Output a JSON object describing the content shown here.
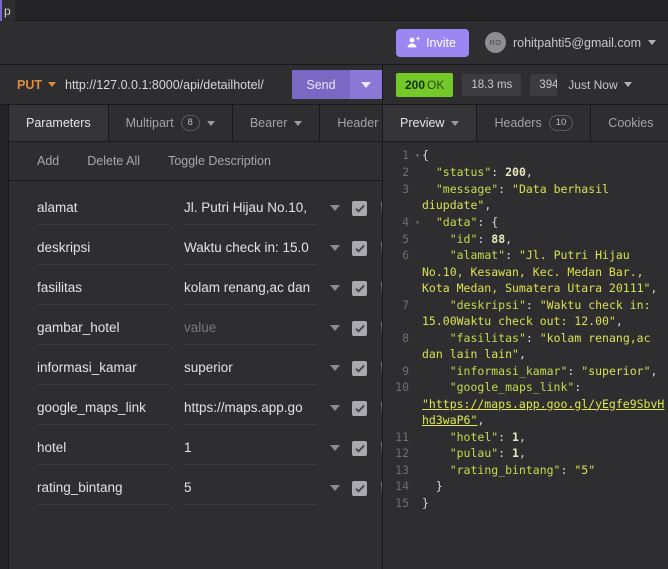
{
  "titlebar": {
    "tab_sliver_label": "p"
  },
  "account": {
    "invite_label": "Invite",
    "invite_icon": "person-plus-icon",
    "avatar_initials": "RO",
    "email": "rohitpahti5@gmail.com",
    "caret_icon": "chevron-down-icon"
  },
  "urlbar": {
    "method": "PUT",
    "method_caret_icon": "chevron-down-icon",
    "url": "http://127.0.0.1:8000/api/detailhotel/",
    "send_label": "Send",
    "send_caret_icon": "chevron-down-icon",
    "status_code": "200",
    "status_text": "OK",
    "time": "18.3 ms",
    "size": "394",
    "timestamp": "Just Now",
    "timestamp_caret_icon": "chevron-down-icon"
  },
  "request_tabs": [
    {
      "label": "Parameters",
      "active": true,
      "badge": null,
      "caret": false
    },
    {
      "label": "Multipart",
      "active": false,
      "badge": "8",
      "caret": true
    },
    {
      "label": "Bearer",
      "active": false,
      "badge": null,
      "caret": true
    },
    {
      "label": "Header",
      "active": false,
      "badge": null,
      "caret": false
    }
  ],
  "request_actions": [
    {
      "label": "Add"
    },
    {
      "label": "Delete All"
    },
    {
      "label": "Toggle Description"
    }
  ],
  "params": [
    {
      "name": "alamat",
      "value": "Jl. Putri Hijau No.10,",
      "is_placeholder": false,
      "enabled": true
    },
    {
      "name": "deskripsi",
      "value": "Waktu check in: 15.0",
      "is_placeholder": false,
      "enabled": true
    },
    {
      "name": "fasilitas",
      "value": "kolam renang,ac dan",
      "is_placeholder": false,
      "enabled": true
    },
    {
      "name": "gambar_hotel",
      "value": "value",
      "is_placeholder": true,
      "enabled": true
    },
    {
      "name": "informasi_kamar",
      "value": "superior",
      "is_placeholder": false,
      "enabled": true
    },
    {
      "name": "google_maps_link",
      "value": "https://maps.app.go",
      "is_placeholder": false,
      "enabled": true
    },
    {
      "name": "hotel",
      "value": "1",
      "is_placeholder": false,
      "enabled": true
    },
    {
      "name": "rating_bintang",
      "value": "5",
      "is_placeholder": false,
      "enabled": true
    }
  ],
  "response_tabs": [
    {
      "label": "Preview",
      "active": true,
      "badge": null,
      "caret": true
    },
    {
      "label": "Headers",
      "active": false,
      "badge": "10",
      "caret": false
    },
    {
      "label": "Cookies",
      "active": false,
      "badge": null,
      "caret": false
    }
  ],
  "response_body": {
    "status": 200,
    "message": "Data berhasil diupdate",
    "data": {
      "id": 88,
      "alamat": "Jl. Putri Hijau No.10, Kesawan, Kec. Medan Bar., Kota Medan, Sumatera Utara 20111",
      "deskripsi": "Waktu check in: 15.00Waktu check out: 12.00",
      "fasilitas": "kolam renang,ac dan lain lain",
      "informasi_kamar": "superior",
      "google_maps_link": "https://maps.app.goo.gl/yEgfe9SbvHhd3waP6",
      "hotel": 1,
      "pulau": 1,
      "rating_bintang": "5"
    }
  },
  "response_lines": [
    {
      "n": "1",
      "fold": true,
      "tokens": [
        {
          "t": "{",
          "c": "p"
        }
      ]
    },
    {
      "n": "2",
      "fold": false,
      "tokens": [
        {
          "t": "  ",
          "c": "p"
        },
        {
          "t": "\"status\"",
          "c": "k"
        },
        {
          "t": ": ",
          "c": "p"
        },
        {
          "t": "200",
          "c": "n"
        },
        {
          "t": ",",
          "c": "p"
        }
      ]
    },
    {
      "n": "3",
      "fold": false,
      "tokens": [
        {
          "t": "  ",
          "c": "p"
        },
        {
          "t": "\"message\"",
          "c": "k"
        },
        {
          "t": ": ",
          "c": "p"
        },
        {
          "t": "\"Data berhasil diupdate\"",
          "c": "s"
        },
        {
          "t": ",",
          "c": "p"
        }
      ]
    },
    {
      "n": "4",
      "fold": true,
      "tokens": [
        {
          "t": "  ",
          "c": "p"
        },
        {
          "t": "\"data\"",
          "c": "k"
        },
        {
          "t": ": {",
          "c": "p"
        }
      ]
    },
    {
      "n": "5",
      "fold": false,
      "tokens": [
        {
          "t": "    ",
          "c": "p"
        },
        {
          "t": "\"id\"",
          "c": "k"
        },
        {
          "t": ": ",
          "c": "p"
        },
        {
          "t": "88",
          "c": "n"
        },
        {
          "t": ",",
          "c": "p"
        }
      ]
    },
    {
      "n": "6",
      "fold": false,
      "tokens": [
        {
          "t": "    ",
          "c": "p"
        },
        {
          "t": "\"alamat\"",
          "c": "k"
        },
        {
          "t": ": ",
          "c": "p"
        },
        {
          "t": "\"Jl. Putri Hijau No.10, Kesawan, Kec. Medan Bar., Kota Medan, Sumatera Utara 20111\"",
          "c": "s"
        },
        {
          "t": ",",
          "c": "p"
        }
      ]
    },
    {
      "n": "7",
      "fold": false,
      "tokens": [
        {
          "t": "    ",
          "c": "p"
        },
        {
          "t": "\"deskripsi\"",
          "c": "k"
        },
        {
          "t": ": ",
          "c": "p"
        },
        {
          "t": "\"Waktu check in: 15.00Waktu check out: 12.00\"",
          "c": "s"
        },
        {
          "t": ",",
          "c": "p"
        }
      ]
    },
    {
      "n": "8",
      "fold": false,
      "tokens": [
        {
          "t": "    ",
          "c": "p"
        },
        {
          "t": "\"fasilitas\"",
          "c": "k"
        },
        {
          "t": ": ",
          "c": "p"
        },
        {
          "t": "\"kolam renang,ac dan lain lain\"",
          "c": "s"
        },
        {
          "t": ",",
          "c": "p"
        }
      ]
    },
    {
      "n": "9",
      "fold": false,
      "tokens": [
        {
          "t": "    ",
          "c": "p"
        },
        {
          "t": "\"informasi_kamar\"",
          "c": "k"
        },
        {
          "t": ": ",
          "c": "p"
        },
        {
          "t": "\"superior\"",
          "c": "s"
        },
        {
          "t": ",",
          "c": "p"
        }
      ]
    },
    {
      "n": "10",
      "fold": false,
      "tokens": [
        {
          "t": "    ",
          "c": "p"
        },
        {
          "t": "\"google_maps_link\"",
          "c": "k"
        },
        {
          "t": ": ",
          "c": "p"
        },
        {
          "t": "\"https://maps.app.goo.gl/yEgfe9SbvHhd3waP6\"",
          "c": "lnk"
        },
        {
          "t": ",",
          "c": "p"
        }
      ]
    },
    {
      "n": "11",
      "fold": false,
      "tokens": [
        {
          "t": "    ",
          "c": "p"
        },
        {
          "t": "\"hotel\"",
          "c": "k"
        },
        {
          "t": ": ",
          "c": "p"
        },
        {
          "t": "1",
          "c": "n"
        },
        {
          "t": ",",
          "c": "p"
        }
      ]
    },
    {
      "n": "12",
      "fold": false,
      "tokens": [
        {
          "t": "    ",
          "c": "p"
        },
        {
          "t": "\"pulau\"",
          "c": "k"
        },
        {
          "t": ": ",
          "c": "p"
        },
        {
          "t": "1",
          "c": "n"
        },
        {
          "t": ",",
          "c": "p"
        }
      ]
    },
    {
      "n": "13",
      "fold": false,
      "tokens": [
        {
          "t": "    ",
          "c": "p"
        },
        {
          "t": "\"rating_bintang\"",
          "c": "k"
        },
        {
          "t": ": ",
          "c": "p"
        },
        {
          "t": "\"5\"",
          "c": "s"
        }
      ]
    },
    {
      "n": "14",
      "fold": false,
      "tokens": [
        {
          "t": "  }",
          "c": "p"
        }
      ]
    },
    {
      "n": "15",
      "fold": false,
      "tokens": [
        {
          "t": "}",
          "c": "p"
        }
      ]
    }
  ],
  "colors": {
    "accent_purple": "#8a77d6",
    "invite_purple": "#9c86f2",
    "status_green": "#74c82a",
    "method_orange": "#e08a3c",
    "json_key": "#c8d94a",
    "background": "#2e2e31"
  }
}
